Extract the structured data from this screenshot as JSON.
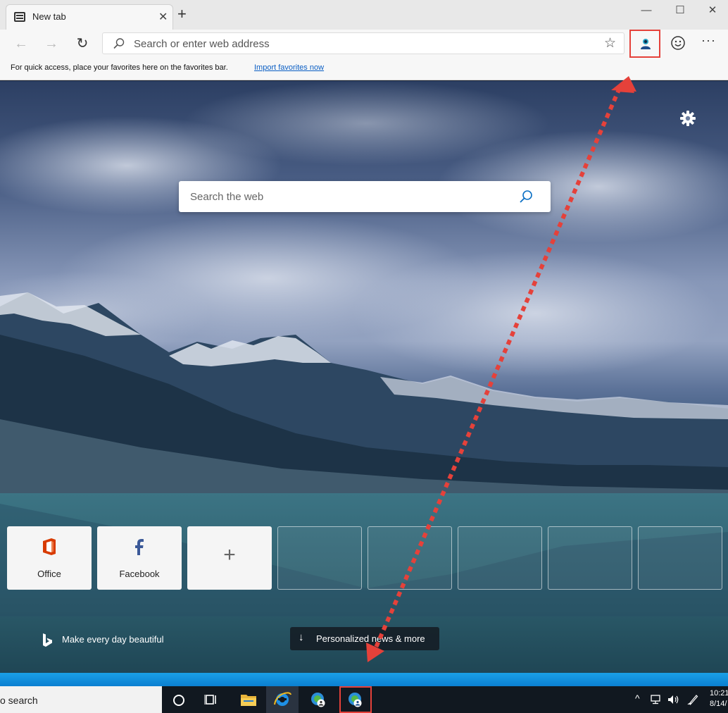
{
  "browser": {
    "tab_title": "New tab",
    "tab_close": "✕",
    "new_tab": "+",
    "window_buttons": [
      "—",
      "☐",
      "✕"
    ]
  },
  "toolbar": {
    "back": "←",
    "forward": "→",
    "refresh": "↻",
    "address_placeholder": "Search or enter web address",
    "favorite_star": "☆",
    "more": "···"
  },
  "favbar": {
    "message": "For quick access, place your favorites here on the favorites bar.",
    "import_link": "Import favorites now"
  },
  "ntp": {
    "search_placeholder": "Search the web",
    "tiles": [
      {
        "label": "Office",
        "icon": "office-icon"
      },
      {
        "label": "Facebook",
        "icon": "facebook-icon"
      },
      {
        "label": "",
        "icon": "plus-icon"
      }
    ],
    "empty_tile_count": 5,
    "bing_text": "Make every day beautiful",
    "news_button": "Personalized news & more",
    "news_arrow": "↓"
  },
  "taskbar": {
    "search_text": "o search",
    "clock_time": "10:21",
    "clock_date": "8/14/",
    "tray_chevron": "^"
  },
  "colors": {
    "highlight": "#e5413a",
    "link": "#0a5ec4",
    "office_orange": "#d83b01",
    "facebook_blue": "#3b5998"
  }
}
